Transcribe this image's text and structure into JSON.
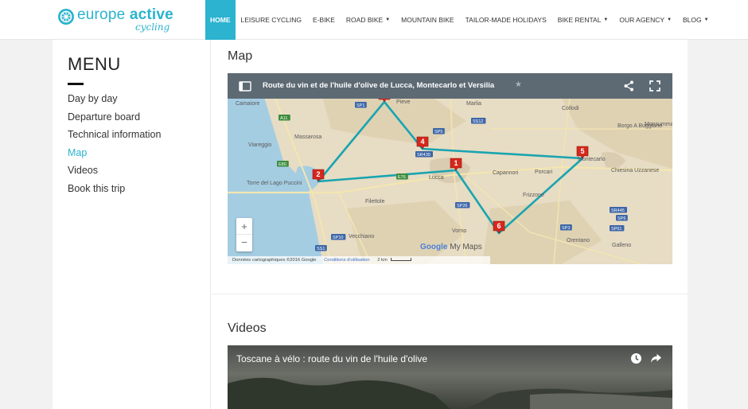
{
  "brand": {
    "name_part1": "europe",
    "name_part2": "active",
    "tagline": "cycling"
  },
  "nav": [
    {
      "label": "HOME",
      "active": true,
      "dropdown": false
    },
    {
      "label": "LEISURE CYCLING",
      "active": false,
      "dropdown": false
    },
    {
      "label": "E-BIKE",
      "active": false,
      "dropdown": false
    },
    {
      "label": "ROAD BIKE",
      "active": false,
      "dropdown": true
    },
    {
      "label": "MOUNTAIN BIKE",
      "active": false,
      "dropdown": false
    },
    {
      "label": "TAILOR-MADE HOLIDAYS",
      "active": false,
      "dropdown": false
    },
    {
      "label": "BIKE RENTAL",
      "active": false,
      "dropdown": true
    },
    {
      "label": "OUR AGENCY",
      "active": false,
      "dropdown": true
    },
    {
      "label": "BLOG",
      "active": false,
      "dropdown": true
    }
  ],
  "sidebar": {
    "title": "MENU",
    "items": [
      {
        "label": "Day by day",
        "active": false
      },
      {
        "label": "Departure board",
        "active": false
      },
      {
        "label": "Technical information",
        "active": false
      },
      {
        "label": "Map",
        "active": true
      },
      {
        "label": "Videos",
        "active": false
      },
      {
        "label": "Book this trip",
        "active": false
      }
    ]
  },
  "map_section": {
    "title": "Map",
    "map_title": "Route du vin et de l'huile d'olive de Lucca, Montecarlo et Versilia",
    "markers": [
      "1",
      "2",
      "3",
      "4",
      "5",
      "6"
    ],
    "places": [
      "Viareggio",
      "Massarosa",
      "Torre del Lago Puccini",
      "Lucca",
      "Capannori",
      "Porcari",
      "Borgo A Buggiano",
      "Montecarlo",
      "Chiesina Uzzanese",
      "Vorno",
      "Vecchiano",
      "Filettole",
      "Frizzone",
      "Orentano",
      "Galleno",
      "Pescia",
      "Collodi",
      "Monsummano",
      "Camaiore",
      "Pieve",
      "Marlia"
    ],
    "road_labels": [
      "SR439",
      "SP1",
      "A11",
      "SS12",
      "E80",
      "E76",
      "SP26",
      "SR445",
      "SP5",
      "SP3",
      "SP61",
      "SP10",
      "SS1",
      "SP6"
    ],
    "google_label": "Google",
    "my_maps_label": "My Maps",
    "attribution": "Données cartographiques ©2016 Google",
    "terms": "Conditions d'utilisation",
    "scale": "2 km",
    "zoom_in": "+",
    "zoom_out": "−",
    "colors": {
      "route": "#1aa4b0",
      "marker": "#d6271b",
      "water": "#a5cde2",
      "land": "#e7dcc4",
      "header": "#5d6a74"
    }
  },
  "videos_section": {
    "title": "Videos",
    "video_title": "Toscane à vélo : route du vin de l'huile d'olive"
  },
  "colors": {
    "accent": "#2bb3cf"
  }
}
